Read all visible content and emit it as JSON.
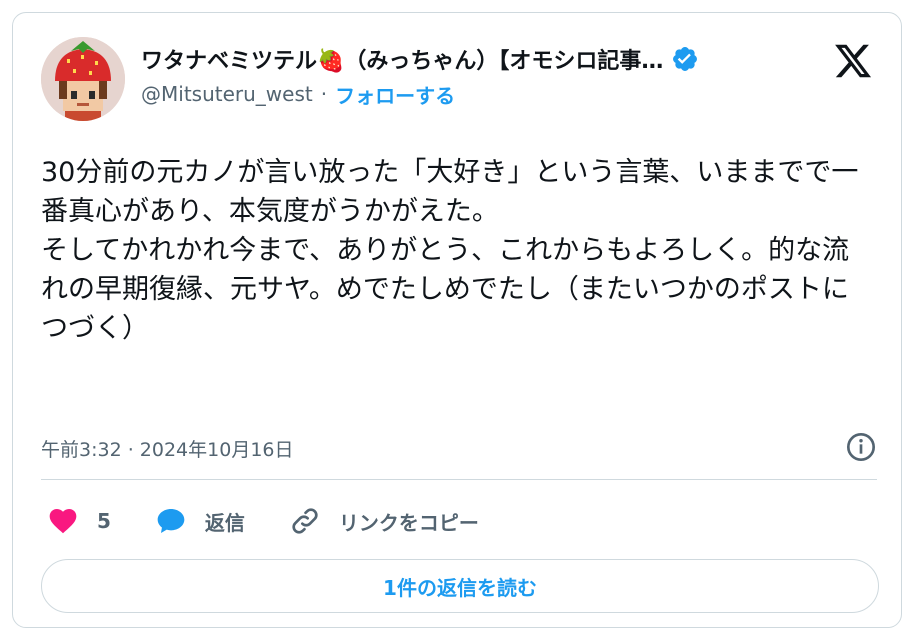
{
  "tweet": {
    "author": {
      "display_name": "ワタナベミツテル🍓（みっちゃん）【オモシロ記事…",
      "handle": "@Mitsuteru_west",
      "separator": "·",
      "follow_label": "フォローする",
      "verified": true,
      "avatar_icon": "strawberry-hat-pixel-avatar"
    },
    "text": "30分前の元カノが言い放った「大好き」という言葉、いままでで一番真心があり、本気度がうかがえた。\nそしてかれかれ今まで、ありがとう、これからもよろしく。的な流れの早期復縁、元サヤ。めでたしめでたし（またいつかのポストにつづく）",
    "timestamp": "午前3:32 · 2024年10月16日",
    "actions": {
      "like_count": "5",
      "reply_label": "返信",
      "copy_link_label": "リンクをコピー"
    },
    "read_replies_label": "1件の返信を読む"
  },
  "colors": {
    "accent": "#1d9bf0",
    "like": "#f91880",
    "text": "#0f1419",
    "muted": "#536471",
    "border": "#cfd9de"
  }
}
